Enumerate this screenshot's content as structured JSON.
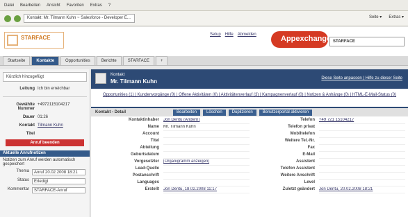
{
  "menu": [
    "Datei",
    "Bearbeiten",
    "Ansicht",
    "Favoriten",
    "Extras",
    "?"
  ],
  "nav": {
    "tab_title": "Kontakt: Mr. Tilmann Kuhn ~ Salesforce - Developer E...",
    "right_items": [
      "Seite ▾",
      "Extras ▾"
    ]
  },
  "header": {
    "logo_text": "STARFACE",
    "links": [
      "Setup",
      "Hilfe",
      "Abmelden"
    ],
    "brand": "Appexchange",
    "search_value": "STARFACE"
  },
  "tabs": [
    "Startseite",
    "Kontakte",
    "Opportunities",
    "Berichte",
    "STARFACE",
    "+"
  ],
  "sidebar": {
    "recent": "Kürzlich hinzugefügt",
    "leitung_label": "Leitung",
    "leitung_value": "Ich bin erreichbar",
    "rows": [
      {
        "label": "Gewählte Nummer",
        "value": "+4972115104217"
      },
      {
        "label": "Dauer",
        "value": "01:26"
      },
      {
        "label": "Kontakt",
        "value": "Tilmann Kuhn"
      },
      {
        "label": "Titel",
        "value": ""
      }
    ],
    "red_button": "Anruf beenden",
    "section_title": "Aktuelle Anrufnotizen",
    "section_text": "Notizen zum Anruf werden automatisch gespeichert",
    "fields": [
      {
        "label": "Thema",
        "value": "Anruf 20.02.2008 18:21"
      },
      {
        "label": "Status",
        "value": "Erledigt"
      },
      {
        "label": "Kommentar",
        "value": "STARFACE-Anruf"
      }
    ]
  },
  "record": {
    "type_label": "Kontakt",
    "name": "Mr. Tilmann Kuhn",
    "top_right": "Diese Seite anpassen | Hilfe zu dieser Seite",
    "related_links": "Opportunities (1) | Kundenvorgänge (0) | Offene Aktivitäten (0) | Aktivitätenverlauf (3) | Kampagnenverlauf (0) | Notizen & Anhänge (0) | HTML-E-Mail-Status (0)",
    "detail_title": "Kontakt - Detail",
    "buttons": [
      "Bearbeiten",
      "Löschen",
      "Duplizieren",
      "Benutzerportal aktivieren"
    ],
    "fields": [
      {
        "l1": "Kontaktinhaber",
        "v1": "Jon Dentu (Ändern)",
        "l2": "Telefon",
        "v2": "+49 721 15104217"
      },
      {
        "l1": "Name",
        "v1": "Mr. Tilmann Kuhn",
        "l2": "Telefon privat",
        "v2": ""
      },
      {
        "l1": "Account",
        "v1": "",
        "l2": "Mobiltelefon",
        "v2": ""
      },
      {
        "l1": "Titel",
        "v1": "",
        "l2": "Weitere Tel.-Nr.",
        "v2": ""
      },
      {
        "l1": "Abteilung",
        "v1": "",
        "l2": "Fax",
        "v2": ""
      },
      {
        "l1": "Geburtsdatum",
        "v1": "",
        "l2": "E-Mail",
        "v2": ""
      },
      {
        "l1": "Vorgesetzter",
        "v1": "[Organigramm anzeigen]",
        "l2": "Assistent",
        "v2": ""
      },
      {
        "l1": "Lead-Quelle",
        "v1": "",
        "l2": "Telefon Assistent",
        "v2": ""
      },
      {
        "l1": "Postanschrift",
        "v1": "",
        "l2": "Weitere Anschrift",
        "v2": ""
      },
      {
        "l1": "Languages",
        "v1": "",
        "l2": "Level",
        "v2": ""
      },
      {
        "l1": "Erstellt",
        "v1": "Jon Dentu, 18.02.2008 11:17",
        "l2": "Zuletzt geändert",
        "v2": "Jon Dentu, 20.02.2008 18:21"
      }
    ]
  }
}
